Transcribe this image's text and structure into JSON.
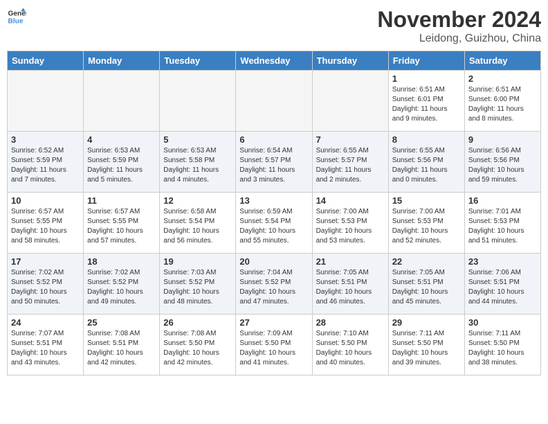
{
  "logo": {
    "text_general": "General",
    "text_blue": "Blue"
  },
  "header": {
    "month": "November 2024",
    "location": "Leidong, Guizhou, China"
  },
  "weekdays": [
    "Sunday",
    "Monday",
    "Tuesday",
    "Wednesday",
    "Thursday",
    "Friday",
    "Saturday"
  ],
  "weeks": [
    [
      {
        "day": "",
        "info": ""
      },
      {
        "day": "",
        "info": ""
      },
      {
        "day": "",
        "info": ""
      },
      {
        "day": "",
        "info": ""
      },
      {
        "day": "",
        "info": ""
      },
      {
        "day": "1",
        "info": "Sunrise: 6:51 AM\nSunset: 6:01 PM\nDaylight: 11 hours\nand 9 minutes."
      },
      {
        "day": "2",
        "info": "Sunrise: 6:51 AM\nSunset: 6:00 PM\nDaylight: 11 hours\nand 8 minutes."
      }
    ],
    [
      {
        "day": "3",
        "info": "Sunrise: 6:52 AM\nSunset: 5:59 PM\nDaylight: 11 hours\nand 7 minutes."
      },
      {
        "day": "4",
        "info": "Sunrise: 6:53 AM\nSunset: 5:59 PM\nDaylight: 11 hours\nand 5 minutes."
      },
      {
        "day": "5",
        "info": "Sunrise: 6:53 AM\nSunset: 5:58 PM\nDaylight: 11 hours\nand 4 minutes."
      },
      {
        "day": "6",
        "info": "Sunrise: 6:54 AM\nSunset: 5:57 PM\nDaylight: 11 hours\nand 3 minutes."
      },
      {
        "day": "7",
        "info": "Sunrise: 6:55 AM\nSunset: 5:57 PM\nDaylight: 11 hours\nand 2 minutes."
      },
      {
        "day": "8",
        "info": "Sunrise: 6:55 AM\nSunset: 5:56 PM\nDaylight: 11 hours\nand 0 minutes."
      },
      {
        "day": "9",
        "info": "Sunrise: 6:56 AM\nSunset: 5:56 PM\nDaylight: 10 hours\nand 59 minutes."
      }
    ],
    [
      {
        "day": "10",
        "info": "Sunrise: 6:57 AM\nSunset: 5:55 PM\nDaylight: 10 hours\nand 58 minutes."
      },
      {
        "day": "11",
        "info": "Sunrise: 6:57 AM\nSunset: 5:55 PM\nDaylight: 10 hours\nand 57 minutes."
      },
      {
        "day": "12",
        "info": "Sunrise: 6:58 AM\nSunset: 5:54 PM\nDaylight: 10 hours\nand 56 minutes."
      },
      {
        "day": "13",
        "info": "Sunrise: 6:59 AM\nSunset: 5:54 PM\nDaylight: 10 hours\nand 55 minutes."
      },
      {
        "day": "14",
        "info": "Sunrise: 7:00 AM\nSunset: 5:53 PM\nDaylight: 10 hours\nand 53 minutes."
      },
      {
        "day": "15",
        "info": "Sunrise: 7:00 AM\nSunset: 5:53 PM\nDaylight: 10 hours\nand 52 minutes."
      },
      {
        "day": "16",
        "info": "Sunrise: 7:01 AM\nSunset: 5:53 PM\nDaylight: 10 hours\nand 51 minutes."
      }
    ],
    [
      {
        "day": "17",
        "info": "Sunrise: 7:02 AM\nSunset: 5:52 PM\nDaylight: 10 hours\nand 50 minutes."
      },
      {
        "day": "18",
        "info": "Sunrise: 7:02 AM\nSunset: 5:52 PM\nDaylight: 10 hours\nand 49 minutes."
      },
      {
        "day": "19",
        "info": "Sunrise: 7:03 AM\nSunset: 5:52 PM\nDaylight: 10 hours\nand 48 minutes."
      },
      {
        "day": "20",
        "info": "Sunrise: 7:04 AM\nSunset: 5:52 PM\nDaylight: 10 hours\nand 47 minutes."
      },
      {
        "day": "21",
        "info": "Sunrise: 7:05 AM\nSunset: 5:51 PM\nDaylight: 10 hours\nand 46 minutes."
      },
      {
        "day": "22",
        "info": "Sunrise: 7:05 AM\nSunset: 5:51 PM\nDaylight: 10 hours\nand 45 minutes."
      },
      {
        "day": "23",
        "info": "Sunrise: 7:06 AM\nSunset: 5:51 PM\nDaylight: 10 hours\nand 44 minutes."
      }
    ],
    [
      {
        "day": "24",
        "info": "Sunrise: 7:07 AM\nSunset: 5:51 PM\nDaylight: 10 hours\nand 43 minutes."
      },
      {
        "day": "25",
        "info": "Sunrise: 7:08 AM\nSunset: 5:51 PM\nDaylight: 10 hours\nand 42 minutes."
      },
      {
        "day": "26",
        "info": "Sunrise: 7:08 AM\nSunset: 5:50 PM\nDaylight: 10 hours\nand 42 minutes."
      },
      {
        "day": "27",
        "info": "Sunrise: 7:09 AM\nSunset: 5:50 PM\nDaylight: 10 hours\nand 41 minutes."
      },
      {
        "day": "28",
        "info": "Sunrise: 7:10 AM\nSunset: 5:50 PM\nDaylight: 10 hours\nand 40 minutes."
      },
      {
        "day": "29",
        "info": "Sunrise: 7:11 AM\nSunset: 5:50 PM\nDaylight: 10 hours\nand 39 minutes."
      },
      {
        "day": "30",
        "info": "Sunrise: 7:11 AM\nSunset: 5:50 PM\nDaylight: 10 hours\nand 38 minutes."
      }
    ]
  ]
}
